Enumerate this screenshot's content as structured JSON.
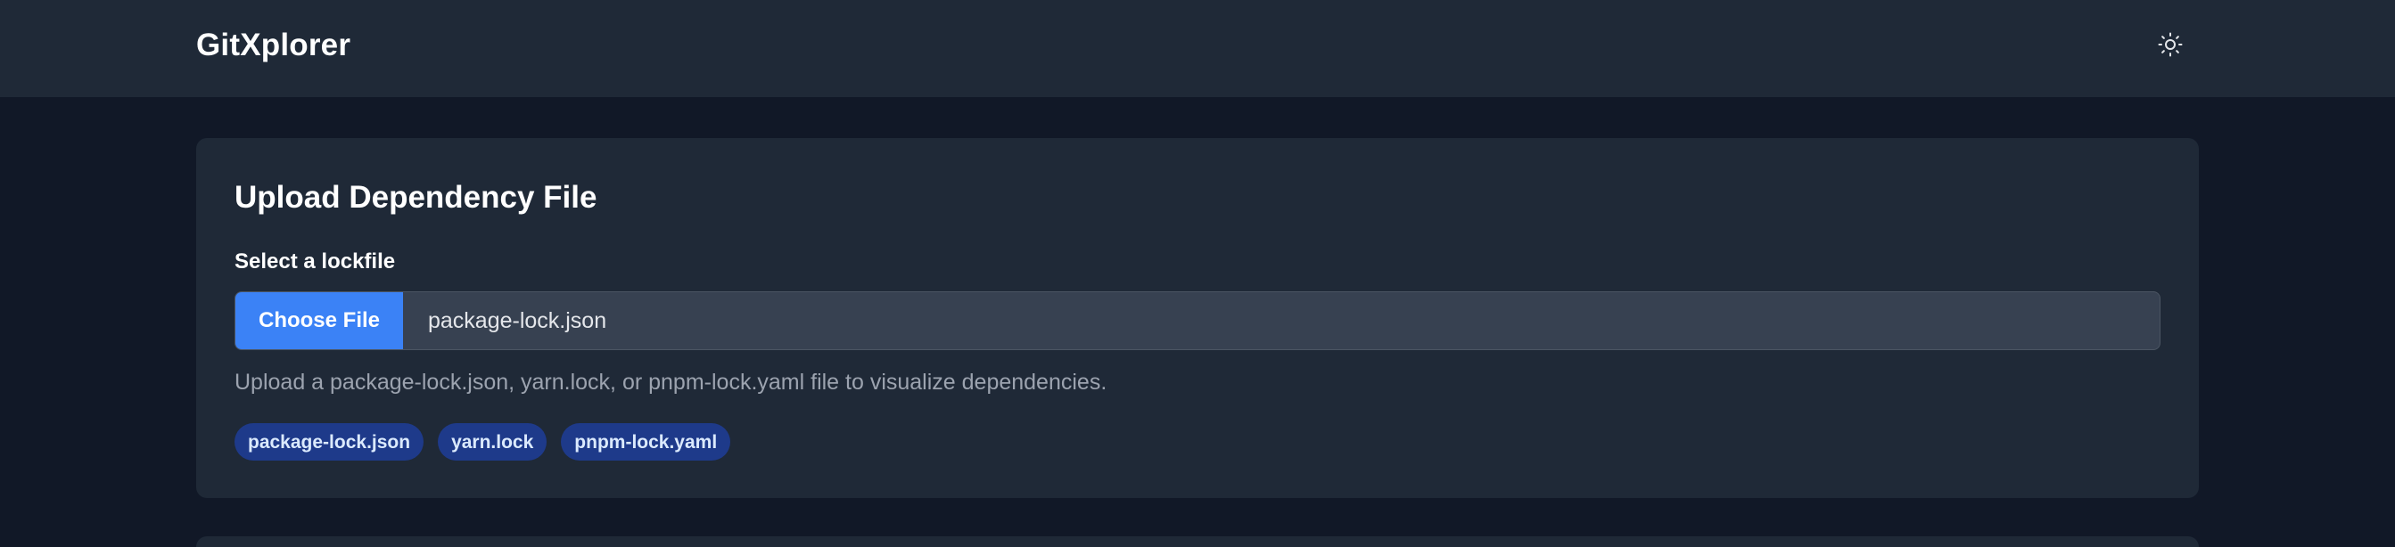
{
  "app": {
    "title": "GitXplorer",
    "theme_toggle_icon": "sun-icon"
  },
  "upload_card": {
    "title": "Upload Dependency File",
    "field_label": "Select a lockfile",
    "choose_button_label": "Choose File",
    "selected_file": "package-lock.json",
    "help_text": "Upload a package-lock.json, yarn.lock, or pnpm-lock.yaml file to visualize dependencies.",
    "supported_formats": [
      "package-lock.json",
      "yarn.lock",
      "pnpm-lock.yaml"
    ]
  },
  "colors": {
    "page_background": "#111827",
    "surface": "#1f2937",
    "input_background": "#374151",
    "accent": "#3b82f6",
    "chip_background": "#1e3a8a",
    "chip_text": "#dbeafe",
    "muted_text": "#9ca3af"
  }
}
